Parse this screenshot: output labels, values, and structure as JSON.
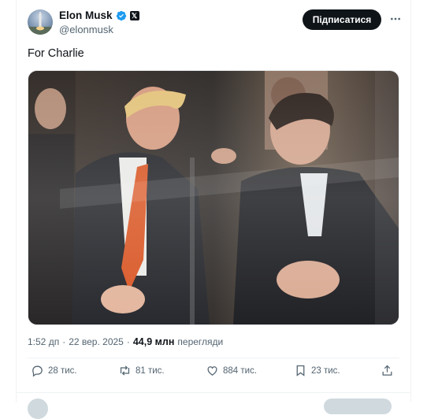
{
  "post": {
    "author_name": "Elon Musk",
    "author_handle": "@elonmusk",
    "follow_label": "Підписатися",
    "text": "For Charlie",
    "time": "1:52 дп",
    "date": "22 вер. 2025",
    "views_count": "44,9 млн",
    "views_label": "перегляди"
  },
  "actions": {
    "replies": "28 тис.",
    "reposts": "81 тис.",
    "likes": "884 тис.",
    "bookmarks": "23 тис."
  },
  "colors": {
    "verified": "#1d9bf0",
    "text_primary": "#0f1419",
    "text_secondary": "#536471",
    "follow_bg": "#0f1419"
  },
  "icons": [
    "verified-badge-icon",
    "x-badge-icon",
    "more-icon",
    "reply-icon",
    "repost-icon",
    "like-icon",
    "bookmark-icon",
    "share-icon"
  ]
}
